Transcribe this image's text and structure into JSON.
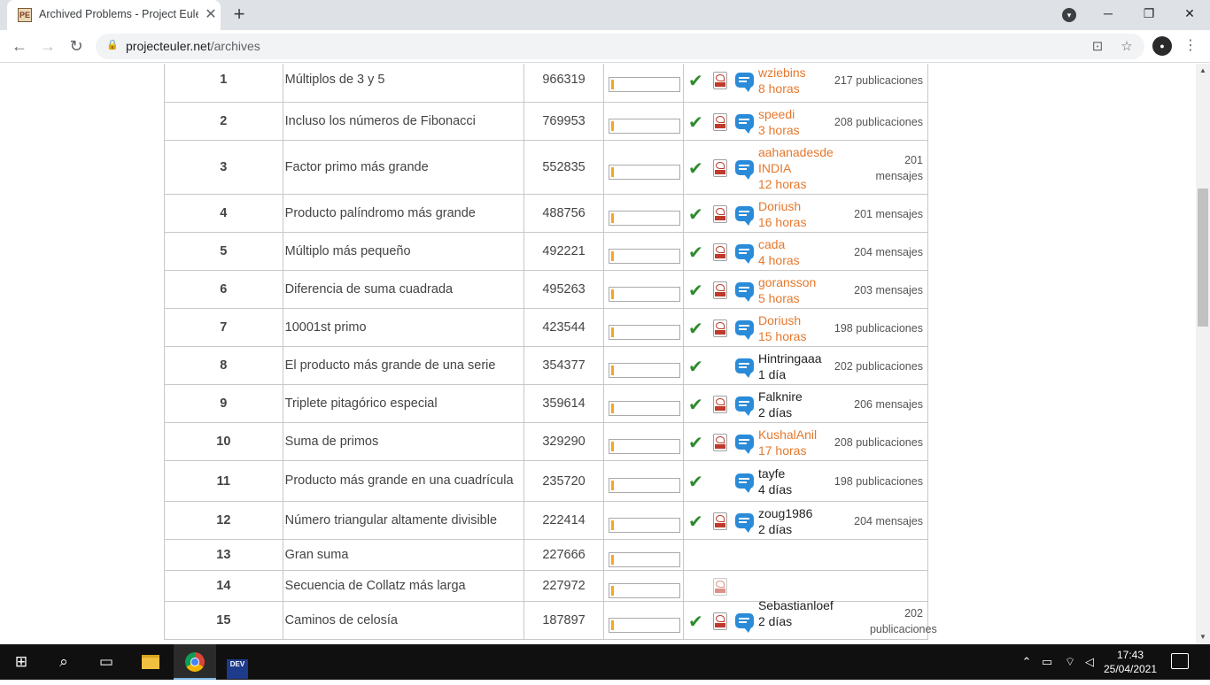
{
  "browser": {
    "tab_title": "Archived Problems - Project Eule",
    "tab_favicon_text": "PE",
    "url_host": "projecteuler.net",
    "url_path": "/archives"
  },
  "problems": [
    {
      "id": "1",
      "title": "Múltiplos de 3 y 5",
      "solved": "966319",
      "progress": 0.03,
      "check": true,
      "pdf": true,
      "forum": true,
      "author": "wziebins",
      "time": "8 horas",
      "posts": "217 publicaciones",
      "author_highlight": true
    },
    {
      "id": "2",
      "title": "Incluso los números de Fibonacci",
      "solved": "769953",
      "progress": 0.03,
      "check": true,
      "pdf": true,
      "forum": true,
      "author": "speedi",
      "time": "3 horas",
      "posts": "208 publicaciones",
      "author_highlight": true
    },
    {
      "id": "3",
      "title": "Factor primo más grande",
      "solved": "552835",
      "progress": 0.03,
      "check": true,
      "pdf": true,
      "forum": true,
      "author": "aahanadesde INDIA",
      "time": "12 horas",
      "posts": "201 mensajes",
      "author_highlight": true
    },
    {
      "id": "4",
      "title": "Producto palíndromo más grande",
      "solved": "488756",
      "progress": 0.03,
      "check": true,
      "pdf": true,
      "forum": true,
      "author": "Doriush",
      "time": "16 horas",
      "posts": "201 mensajes",
      "author_highlight": true
    },
    {
      "id": "5",
      "title": "Múltiplo más pequeño",
      "solved": "492221",
      "progress": 0.03,
      "check": true,
      "pdf": true,
      "forum": true,
      "author": "cada",
      "time": "4 horas",
      "posts": "204 mensajes",
      "author_highlight": true
    },
    {
      "id": "6",
      "title": "Diferencia de suma cuadrada",
      "solved": "495263",
      "progress": 0.03,
      "check": true,
      "pdf": true,
      "forum": true,
      "author": "goransson",
      "time": "5 horas",
      "posts": "203 mensajes",
      "author_highlight": true
    },
    {
      "id": "7",
      "title": "10001st primo",
      "solved": "423544",
      "progress": 0.03,
      "check": true,
      "pdf": true,
      "forum": true,
      "author": "Doriush",
      "time": "15 horas",
      "posts": "198 publicaciones",
      "author_highlight": true
    },
    {
      "id": "8",
      "title": "El producto más grande de una serie",
      "solved": "354377",
      "progress": 0.03,
      "check": true,
      "pdf": false,
      "forum": true,
      "author": "Hintringaaa",
      "time": "1 día",
      "posts": "202 publicaciones",
      "author_highlight": false
    },
    {
      "id": "9",
      "title": "Triplete pitagórico especial",
      "solved": "359614",
      "progress": 0.03,
      "check": true,
      "pdf": true,
      "forum": true,
      "author": "Falknire",
      "time": "2 días",
      "posts": "206 mensajes",
      "author_highlight": false
    },
    {
      "id": "10",
      "title": "Suma de primos",
      "solved": "329290",
      "progress": 0.03,
      "check": true,
      "pdf": true,
      "forum": true,
      "author": "KushalAnil",
      "time": "17 horas",
      "posts": "208 publicaciones",
      "author_highlight": true
    },
    {
      "id": "11",
      "title": "Producto más grande en una cuadrícula",
      "solved": "235720",
      "progress": 0.03,
      "check": true,
      "pdf": false,
      "forum": true,
      "author": "tayfe",
      "time": "4 días",
      "posts": "198 publicaciones",
      "author_highlight": false
    },
    {
      "id": "12",
      "title": "Número triangular altamente divisible",
      "solved": "222414",
      "progress": 0.03,
      "check": true,
      "pdf": true,
      "forum": true,
      "author": "zoug1986",
      "time": "2 días",
      "posts": "204 mensajes",
      "author_highlight": false
    },
    {
      "id": "13",
      "title": "Gran suma",
      "solved": "227666",
      "progress": 0.03,
      "check": false,
      "pdf": false,
      "forum": false,
      "author": "",
      "time": "",
      "posts": "",
      "author_highlight": false
    },
    {
      "id": "14",
      "title": "Secuencia de Collatz más larga",
      "solved": "227972",
      "progress": 0.03,
      "check": false,
      "pdf": true,
      "pdf_gray": true,
      "forum": false,
      "author": "",
      "time": "",
      "posts": "",
      "author_highlight": false
    },
    {
      "id": "15",
      "title": "Caminos de celosía",
      "solved": "187897",
      "progress": 0.03,
      "check": true,
      "pdf": true,
      "forum": true,
      "author": "Sebastianloef",
      "time": "2 días",
      "posts": "202 publicaciones",
      "author_highlight": false
    }
  ],
  "taskbar": {
    "time": "17:43",
    "date": "25/04/2021",
    "dev_label": "DEV"
  },
  "colors": {
    "author_link": "#e5782d",
    "check": "#2e8b2e",
    "progress": "#f5a623",
    "forum_icon": "#2a8bd8"
  }
}
